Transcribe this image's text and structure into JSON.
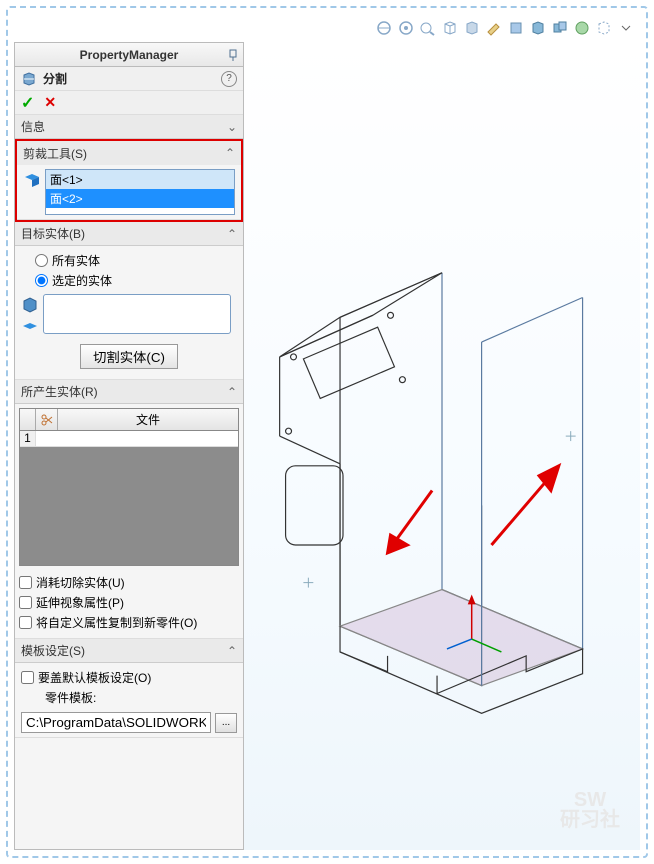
{
  "panel": {
    "title": "PropertyManager",
    "command": "分割",
    "ok_symbol": "✓",
    "cancel_symbol": "✕",
    "help_symbol": "?"
  },
  "sections": {
    "info": {
      "label": "信息"
    },
    "trim": {
      "label": "剪裁工具(S)",
      "items": [
        "面<1>",
        "面<2>"
      ]
    },
    "target": {
      "label": "目标实体(B)",
      "radio_all": "所有实体",
      "radio_selected": "选定的实体",
      "cut_button": "切割实体(C)"
    },
    "result": {
      "label": "所产生实体(R)",
      "col_file": "文件",
      "row1": "1"
    },
    "checks": {
      "consume": "消耗切除实体(U)",
      "extend": "延伸视象属性(P)",
      "copy": "将自定义属性复制到新零件(O)"
    },
    "template": {
      "label": "模板设定(S)",
      "override": "要盖默认模板设定(O)",
      "part_template": "零件模板:",
      "path": "C:\\ProgramData\\SOLIDWORKS",
      "browse": "..."
    }
  },
  "watermark": {
    "line1": "SW",
    "line2": "研习社"
  }
}
